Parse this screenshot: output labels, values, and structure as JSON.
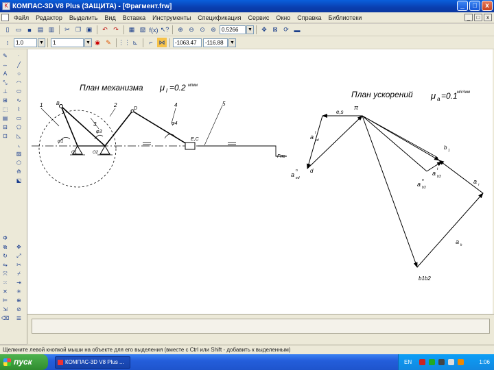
{
  "window": {
    "title": "КОМПАС-3D V8 Plus (ЗАЩИТА) - [Фрагмент.frw]",
    "controls": {
      "minimize": "_",
      "maximize": "□",
      "close": "x"
    }
  },
  "menu": {
    "items": [
      "Файл",
      "Редактор",
      "Выделить",
      "Вид",
      "Вставка",
      "Инструменты",
      "Спецификация",
      "Сервис",
      "Окно",
      "Справка",
      "Библиотеки"
    ],
    "mdi_controls": [
      "_",
      "□",
      "x"
    ]
  },
  "toolbar1": {
    "zoom_value": "0.5266"
  },
  "toolbar2": {
    "style_value": "1.0",
    "layer_value": "1",
    "coord_x": "-1063.47",
    "coord_y": "-116.88"
  },
  "drawing": {
    "mechanism_caption": "План механизма",
    "mechanism_scale": "μ",
    "mechanism_scale_sub": "l",
    "mechanism_scale_value": "=0.2",
    "mechanism_scale_unit": "м/мм",
    "accel_caption": "План ускорений",
    "accel_scale": "μ",
    "accel_scale_sub": "a",
    "accel_scale_value": "=0.1",
    "accel_scale_unit": "м/с²мм",
    "labels": {
      "pi": "π",
      "es": "e,s",
      "d": "d",
      "b1": "b",
      "b1_sub": "1",
      "b1b2": "b1b2",
      "a_ed_t": "a",
      "a_ed_t_sub": "ed",
      "a_ed_t_sup": "t",
      "a_ed_n": "a",
      "a_ed_n_sub": "ed",
      "a_ed_n_sup": "n",
      "a_b3_t": "a",
      "a_b3_t_sub": "b3",
      "a_b3_t_sup": "t",
      "a_b3_n": "a",
      "a_b3_n_sub": "b3",
      "a_b3_n_sup": "n",
      "a_r": "a",
      "a_r_sub": "r",
      "a_k": "a",
      "a_k_sub": "k",
      "point_B": "B",
      "point_D": "D",
      "point_E": "E,C",
      "point_O1": "O1",
      "point_O2": "O2",
      "pos_1": "1",
      "pos_2": "2",
      "pos_3": "3",
      "pos_4": "4",
      "pos_5": "5",
      "phi1": "φ1",
      "phi3": "φ3",
      "phi4": "φ4",
      "fpc": "Fпс"
    }
  },
  "status": {
    "hint": "Щелкните левой кнопкой мыши на объекте для его выделения (вместе с Ctrl или Shift - добавить к выделенным)"
  },
  "taskbar": {
    "start_label": "пуск",
    "task_label": "КОМПАС-3D V8 Plus ...",
    "lang": "EN",
    "clock": "1:06"
  }
}
